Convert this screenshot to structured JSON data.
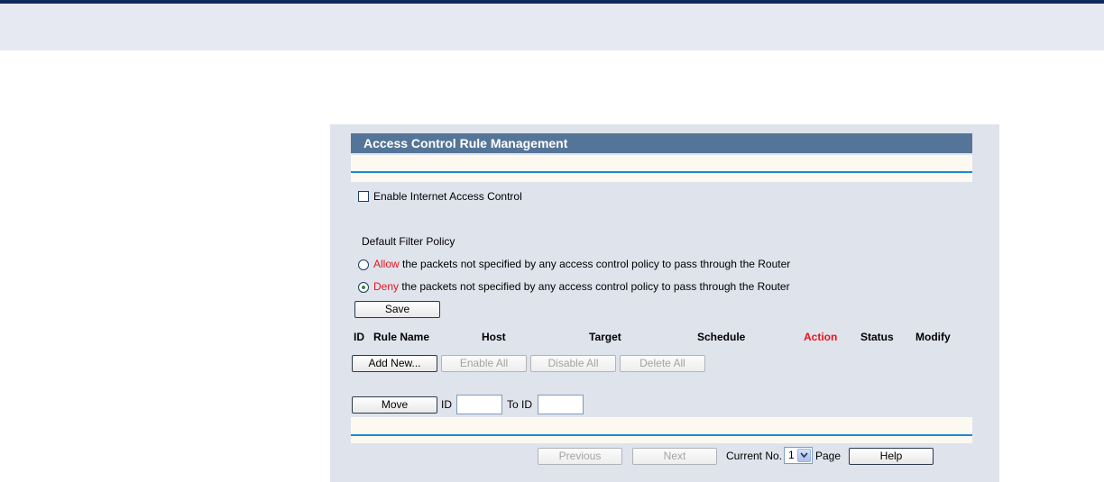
{
  "panel": {
    "title": "Access Control Rule Management"
  },
  "enable": {
    "label": "Enable Internet Access Control",
    "checked": false
  },
  "policy": {
    "heading": "Default Filter Policy",
    "allow_keyword": "Allow",
    "allow_text": " the packets not specified by any access control policy to pass through the Router",
    "deny_keyword": "Deny",
    "deny_text": " the packets not specified by any access control policy to pass through the Router",
    "selected": "Deny",
    "save_label": "Save"
  },
  "table": {
    "headers": [
      "ID",
      "Rule Name",
      "Host",
      "Target",
      "Schedule",
      "Action",
      "Status",
      "Modify"
    ]
  },
  "buttons": {
    "add_new": "Add New...",
    "enable_all": "Enable All",
    "disable_all": "Disable All",
    "delete_all": "Delete All",
    "move": "Move"
  },
  "move": {
    "id_label": "ID",
    "to_id_label": "To ID",
    "id_value": "",
    "to_id_value": ""
  },
  "pager": {
    "previous": "Previous",
    "next": "Next",
    "current_label": "Current No.",
    "current_value": "1",
    "page_label": "Page",
    "help": "Help"
  },
  "colors": {
    "title_bar": "#557598",
    "accent_red": "#e8141e",
    "blue_line": "#1a8ad4",
    "panel_bg": "#dfe3ec"
  }
}
